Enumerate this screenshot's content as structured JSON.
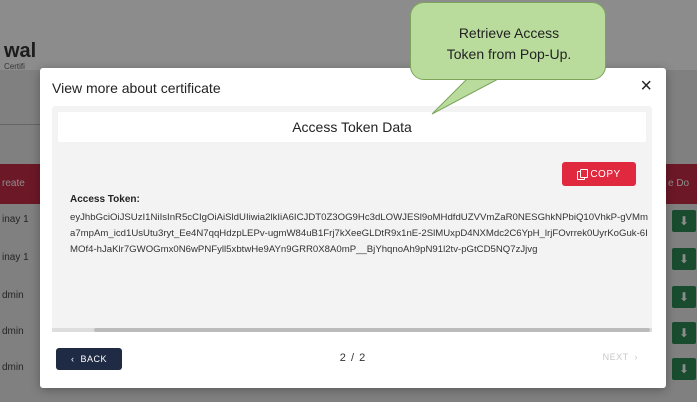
{
  "background": {
    "app_title_fragment": "wal",
    "app_subtitle_fragment": "Certifi",
    "column_left_fragment": "reate",
    "column_right_fragment": "e Do",
    "rows": [
      "inay 1",
      "inay 1",
      "dmin",
      "dmin",
      "dmin"
    ],
    "download_icon": "download-icon"
  },
  "modal": {
    "title": "View more about certificate",
    "close_symbol": "×",
    "panel_title": "Access Token Data",
    "copy_label": "COPY",
    "token_label": "Access Token:",
    "token_value": "eyJhbGciOiJSUzI1NiIsInR5cCIgOiAiSldUIiwia2lkIiA6ICJDT0Z3OG9Hc3dLOWJESl9oMHdfdUZVVmZaR0NESGhkNPbiQ10VhkP-gVMma7mpAm_icd1UsUtu3ryt_Ee4N7qqHdzpLEPv-ugmW84uB1Frj7kXeeGLDtR9x1nE-2SlMUxpD4NXMdc2C6YpH_lrjFOvrrek0UyrKoGuk-6IMOf4-hJaKlr7GWOGmx0N6wPNFyll5xbtwHe9AYn9GRR0X8A0mP__BjYhqnoAh9pN91l2tv-pGtCD5NQ7zJjvg",
    "back_label": "BACK",
    "pager": "2 / 2",
    "next_label": "NEXT"
  },
  "callout": {
    "line1": "Retrieve Access",
    "line2": "Token from Pop-Up."
  },
  "colors": {
    "copy_button": "#e0293f",
    "back_button": "#1f2a44",
    "callout_fill": "#b9dc9d",
    "header_red": "#c72c48",
    "download_green": "#2e8b57"
  }
}
